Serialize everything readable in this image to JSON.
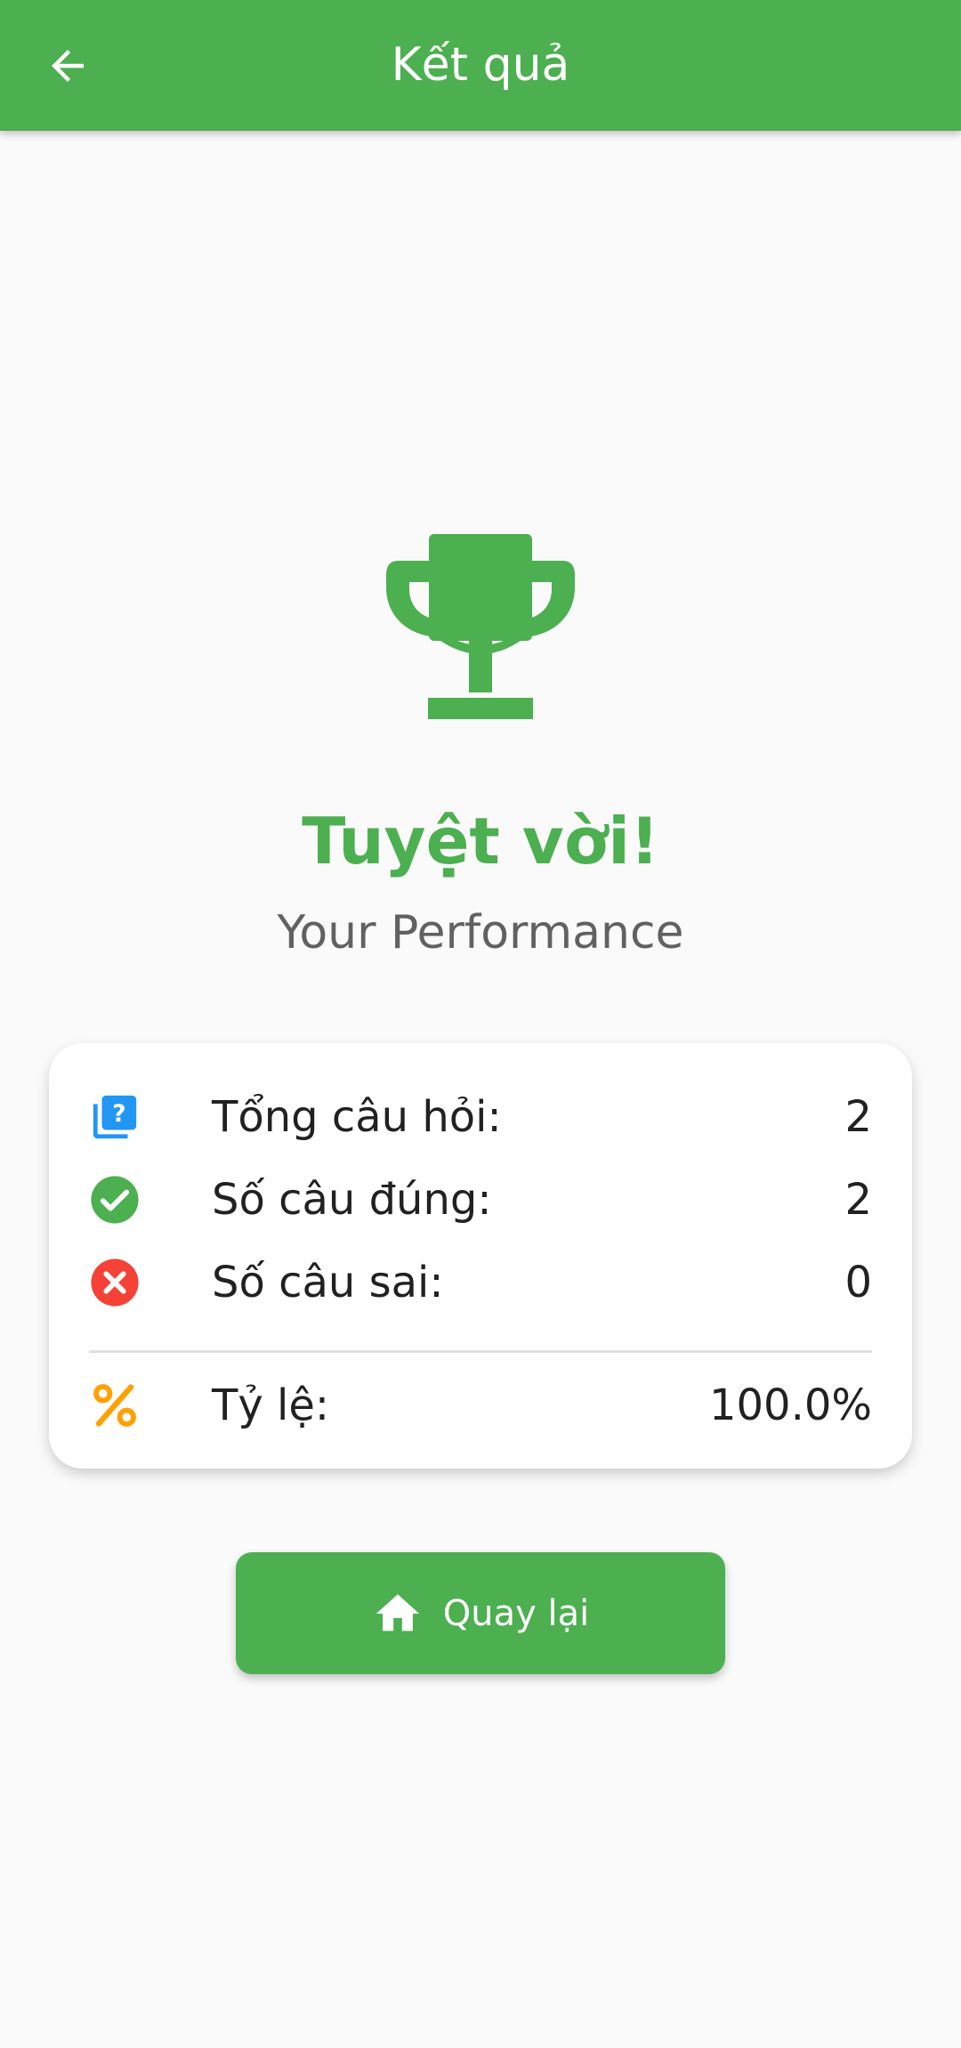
{
  "app_bar": {
    "title": "Kết quả",
    "back_icon": "arrow-back-icon"
  },
  "colors": {
    "primary": "#4caf50",
    "background": "#fafafa",
    "question_icon": "#2196f3",
    "correct_icon": "#4caf50",
    "wrong_icon": "#f44336",
    "percent_icon": "#ffa000"
  },
  "result": {
    "icon": "trophy-icon",
    "headline": "Tuyệt vời!",
    "subtitle": "Your Performance"
  },
  "stats": {
    "total": {
      "icon": "quiz-icon",
      "label": "Tổng câu hỏi:",
      "value": "2"
    },
    "correct": {
      "icon": "check-circle-icon",
      "label": "Số câu đúng:",
      "value": "2"
    },
    "wrong": {
      "icon": "cancel-icon",
      "label": "Số câu sai:",
      "value": "0"
    },
    "rate": {
      "icon": "percent-icon",
      "label": "Tỷ lệ:",
      "value": "100.0%"
    }
  },
  "home_button": {
    "icon": "home-icon",
    "label": "Quay lại"
  }
}
